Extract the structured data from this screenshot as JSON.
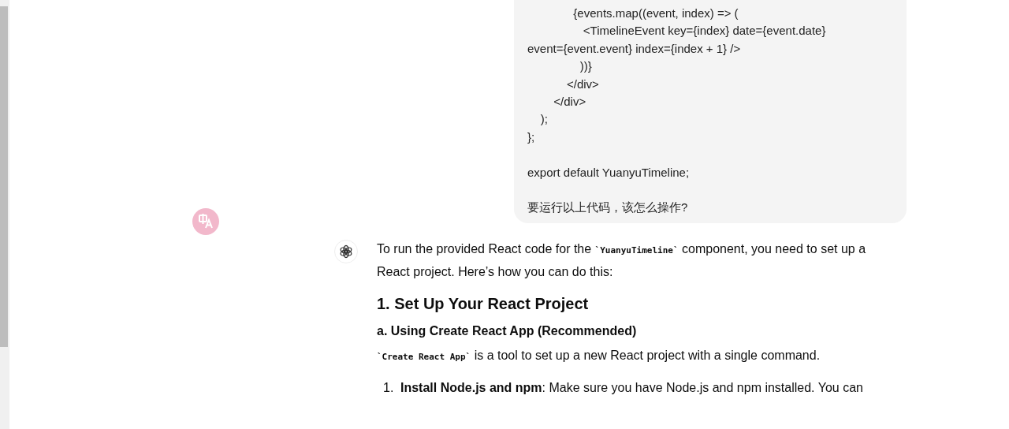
{
  "user_message": {
    "paragraphs": [
      [
        "              {events.map((event, index) => (",
        "                 <TimelineEvent key={index} date={event.date}",
        "event={event.event} index={index + 1} />",
        "                ))}",
        "            </div>",
        "        </div>",
        "    );",
        "};"
      ],
      [
        "export default YuanyuTimeline;"
      ],
      [
        "要运行以上代码，该怎么操作?"
      ]
    ]
  },
  "assistant_message": {
    "blocks": [
      {
        "kind": "paragraph",
        "segments": [
          {
            "kind": "text",
            "text": "To run the provided React code for the "
          },
          {
            "kind": "code",
            "text": "`YuanyuTimeline`"
          },
          {
            "kind": "text",
            "text": " component, you need to set up a React project. Here’s how you can do this:"
          }
        ]
      },
      {
        "kind": "heading",
        "text": "1. Set Up Your React Project"
      },
      {
        "kind": "subheading",
        "text": "a. Using Create React App (Recommended)"
      },
      {
        "kind": "paragraph",
        "segments": [
          {
            "kind": "code",
            "text": "`Create React App`"
          },
          {
            "kind": "text",
            "text": " is a tool to set up a new React project with a single command."
          }
        ]
      },
      {
        "kind": "list_item",
        "marker": "1.",
        "text": "**Install Node.js and npm**: Make sure you have Node.js and npm installed. You can"
      }
    ]
  }
}
